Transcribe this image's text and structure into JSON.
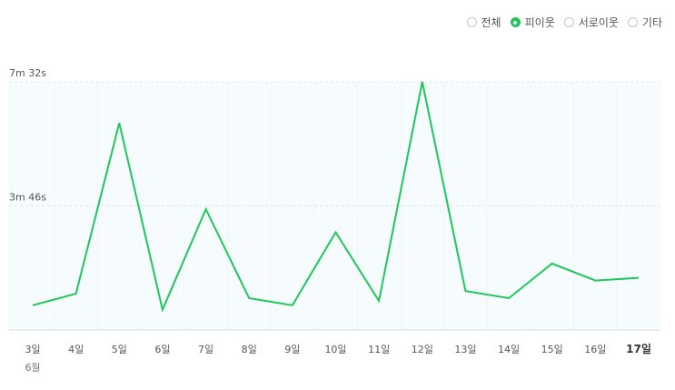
{
  "legend": [
    {
      "label": "전체",
      "selected": false
    },
    {
      "label": "피이웃",
      "selected": true
    },
    {
      "label": "서로이웃",
      "selected": false
    },
    {
      "label": "기타",
      "selected": false
    }
  ],
  "chart_data": {
    "type": "line",
    "categories": [
      "3일",
      "4일",
      "5일",
      "6일",
      "7일",
      "8일",
      "9일",
      "10일",
      "11일",
      "12일",
      "13일",
      "14일",
      "15일",
      "16일",
      "17일"
    ],
    "month_label": "6월",
    "highlight_category": "17일",
    "y_ticks": [
      {
        "seconds": 226,
        "label": "3m 46s"
      },
      {
        "seconds": 452,
        "label": "7m 32s"
      }
    ],
    "ylim": [
      0,
      452
    ],
    "series": [
      {
        "values": [
          45,
          66,
          377,
          37,
          220,
          58,
          45,
          178,
          53,
          452,
          71,
          58,
          121,
          90,
          95
        ],
        "color": "#1ec75a"
      }
    ],
    "grid": true,
    "legend_position": "top-right",
    "plot_background": "#f6fbfe",
    "grid_color": "#d9e9f3"
  }
}
